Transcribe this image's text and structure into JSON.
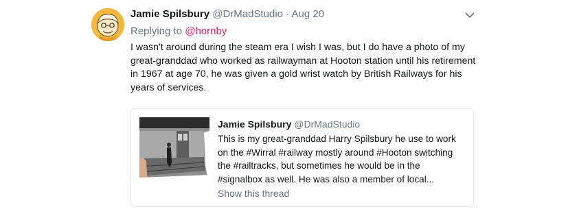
{
  "tweet": {
    "author_name": "Jamie Spilsbury",
    "author_handle": "@DrMadStudio",
    "separator": "·",
    "timestamp": "Aug 20",
    "replying_prefix": "Replying to",
    "replying_to": "@hornby",
    "text_lines": [
      "I wasn't around during the steam era I wish I was, but I do have a photo of my",
      "great-granddad who worked as railwayman at Hooton station until his retirement",
      "in 1967 at age 70, he was given a gold wrist watch by British Railways for his",
      "years of services."
    ],
    "menu_icon": "chevron-down-icon",
    "avatar_icon": "avatar-illustration"
  },
  "quoted_tweet": {
    "author_name": "Jamie Spilsbury",
    "author_handle": "@DrMadStudio",
    "text_lines": [
      "This is my great-granddad Harry Spilsbury he use to work",
      "on the #Wirral #railway mostly around #Hooton switching",
      "the #railtracks, but sometimes he would be in the",
      "#signalbox as well. He was also a member of local..."
    ],
    "show_thread": "Show this thread",
    "thumbnail": "photo-thumbnail"
  },
  "colors": {
    "text": "#14171a",
    "secondary": "#657786",
    "mention": "#e0245e",
    "border": "#e1e8ed"
  }
}
